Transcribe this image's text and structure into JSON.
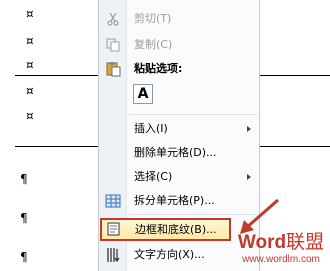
{
  "document": {
    "cell_mark": "¤",
    "paragraph_mark": "¶"
  },
  "context_menu": {
    "items": [
      {
        "label": "剪切(T)",
        "enabled": false,
        "icon": "scissors-icon"
      },
      {
        "label": "复制(C)",
        "enabled": false,
        "icon": "copy-icon"
      },
      {
        "label": "粘贴选项:",
        "section_header": true,
        "icon": "paste-icon"
      },
      {
        "label": "A",
        "paste_option": true
      },
      {
        "label": "插入(I)",
        "submenu": true
      },
      {
        "label": "删除单元格(D)...",
        "submenu": false
      },
      {
        "label": "选择(C)",
        "submenu": true
      },
      {
        "label": "拆分单元格(P)...",
        "icon": "split-cells-icon"
      },
      {
        "label": "边框和底纹(B)...",
        "highlighted": true,
        "icon": "borders-icon"
      },
      {
        "label": "文字方向(X)...",
        "icon": "text-direction-icon"
      }
    ]
  },
  "watermark": {
    "brand_a": "Word",
    "brand_b": "联盟",
    "url": "www.wordlm.com"
  },
  "colors": {
    "highlight_border": "#c0392b",
    "arrow": "#c0392b"
  }
}
